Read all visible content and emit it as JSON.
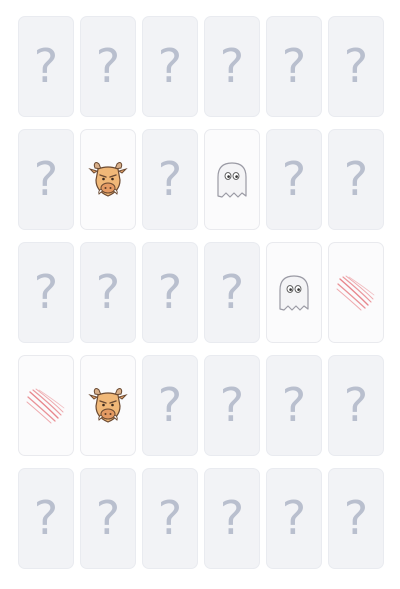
{
  "game": {
    "hidden_symbol": "?",
    "columns": 6,
    "cards": [
      {
        "state": "hidden",
        "face": null
      },
      {
        "state": "hidden",
        "face": null
      },
      {
        "state": "hidden",
        "face": null
      },
      {
        "state": "hidden",
        "face": null
      },
      {
        "state": "hidden",
        "face": null
      },
      {
        "state": "hidden",
        "face": null
      },
      {
        "state": "hidden",
        "face": null
      },
      {
        "state": "revealed",
        "face": "boar-icon"
      },
      {
        "state": "hidden",
        "face": null
      },
      {
        "state": "revealed",
        "face": "ghost-icon"
      },
      {
        "state": "hidden",
        "face": null
      },
      {
        "state": "hidden",
        "face": null
      },
      {
        "state": "hidden",
        "face": null
      },
      {
        "state": "hidden",
        "face": null
      },
      {
        "state": "hidden",
        "face": null
      },
      {
        "state": "hidden",
        "face": null
      },
      {
        "state": "revealed",
        "face": "ghost-icon"
      },
      {
        "state": "revealed",
        "face": "claw-scratch-icon"
      },
      {
        "state": "revealed",
        "face": "claw-scratch-icon"
      },
      {
        "state": "revealed",
        "face": "boar-icon"
      },
      {
        "state": "hidden",
        "face": null
      },
      {
        "state": "hidden",
        "face": null
      },
      {
        "state": "hidden",
        "face": null
      },
      {
        "state": "hidden",
        "face": null
      },
      {
        "state": "hidden",
        "face": null
      },
      {
        "state": "hidden",
        "face": null
      },
      {
        "state": "hidden",
        "face": null
      },
      {
        "state": "hidden",
        "face": null
      },
      {
        "state": "hidden",
        "face": null
      },
      {
        "state": "hidden",
        "face": null
      }
    ]
  },
  "colors": {
    "card_hidden_bg": "#f2f3f6",
    "card_revealed_bg": "#fbfbfc",
    "question_mark": "#b9bfce",
    "boar_fur": "#f0b878",
    "claw_scratch": "#e8868c",
    "ghost_body": "#f4f4f6"
  }
}
